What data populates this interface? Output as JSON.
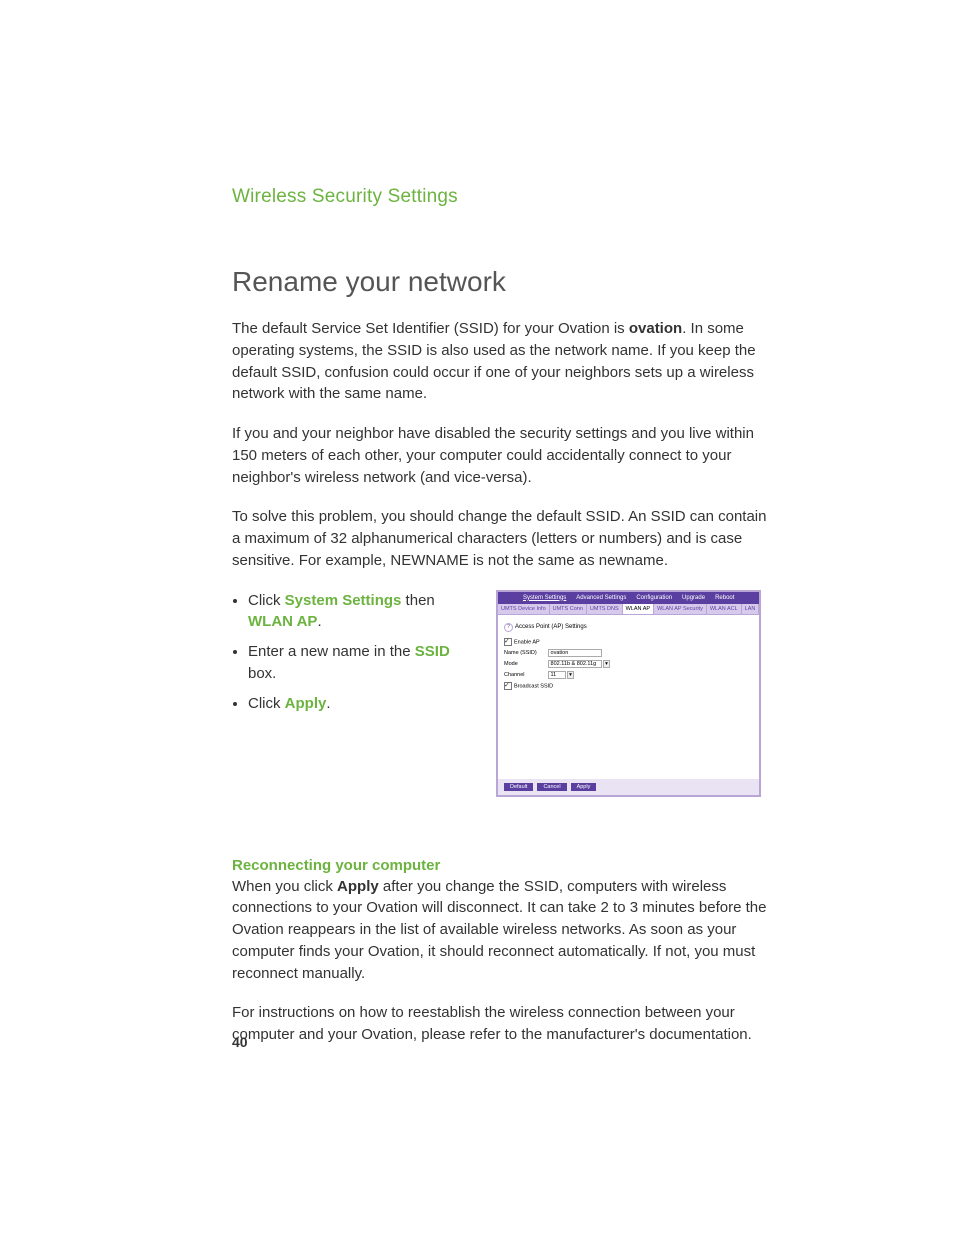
{
  "header": {
    "section": "Wireless Security Settings"
  },
  "title": "Rename your network",
  "para1": {
    "pre": "The default Service Set Identifier (SSID) for your Ovation is ",
    "bold": "ovation",
    "post": ". In some operating systems, the SSID is also used as the network name. If you keep the default SSID, confusion could occur if one of your neighbors sets up a wireless network with the same name."
  },
  "para2": "If you and your neighbor have disabled the security settings and you live within 150 meters of each other, your computer could accidentally connect to your neighbor's wireless network (and vice-versa).",
  "para3": "To solve this problem, you should change the default SSID. An SSID can contain a maximum of 32 alphanumerical characters (letters or numbers) and is case sensitive. For example, NEWNAME is not the same as newname.",
  "bullets": {
    "b1": {
      "pre": "Click ",
      "g1": "System Settings",
      "mid": " then ",
      "g2": "WLAN AP",
      "post": "."
    },
    "b2": {
      "pre": "Enter a new name in the ",
      "g": "SSID",
      "post": " box."
    },
    "b3": {
      "pre": "Click ",
      "g": "Apply",
      "post": "."
    }
  },
  "shot": {
    "nav": [
      "System Settings",
      "Advanced Settings",
      "Configuration",
      "Upgrade",
      "Reboot"
    ],
    "nav_active": "System Settings",
    "tabs": [
      "UMTS Device Info",
      "UMTS Conn",
      "UMTS DNS",
      "WLAN AP",
      "WLAN AP Security",
      "WLAN ACL",
      "LAN"
    ],
    "tab_active": "WLAN AP",
    "panel_title": "Access Point (AP) Settings",
    "enable_label": "Enable AP",
    "name_label": "Name (SSID)",
    "name_value": "ovation",
    "mode_label": "Mode",
    "mode_value": "802.11b & 802.11g",
    "channel_label": "Channel",
    "channel_value": "11",
    "broadcast_label": "Broadcast SSID",
    "buttons": {
      "default": "Default",
      "cancel": "Cancel",
      "apply": "Apply"
    }
  },
  "reconnect": {
    "head": "Reconnecting your computer",
    "p1": {
      "pre": "When you click ",
      "bold": "Apply",
      "post": " after you change the SSID, computers with wireless connections to your Ovation will disconnect. It can take 2 to 3 minutes before the Ovation reappears in the list of available wireless networks. As soon as your computer finds your Ovation, it should reconnect automatically. If not, you must reconnect manually."
    },
    "p2": "For instructions on how to reestablish the wireless connection between your computer and your Ovation, please refer to the manufacturer's documentation."
  },
  "page_number": "40"
}
